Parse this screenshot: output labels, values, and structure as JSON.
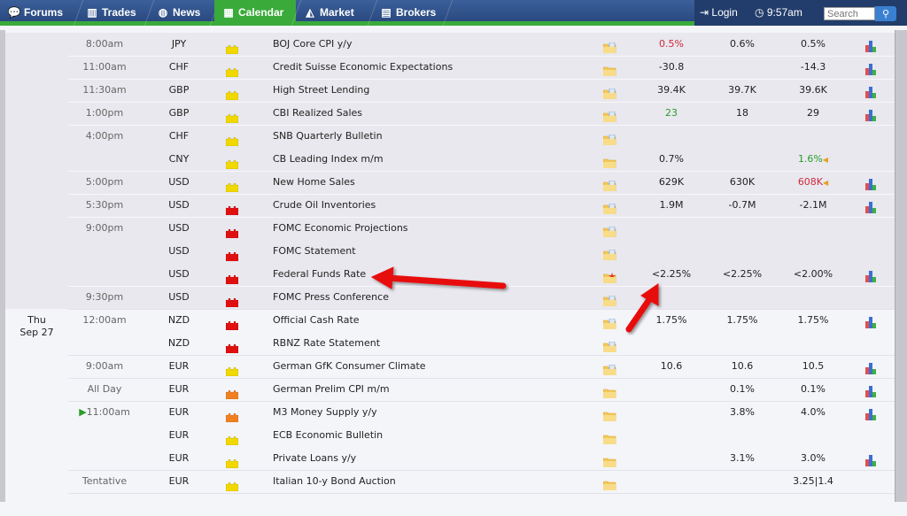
{
  "nav": {
    "tabs": [
      {
        "label": "Forums",
        "icon": "chat-bubbles-icon",
        "active": false
      },
      {
        "label": "Trades",
        "icon": "bar-chart-icon",
        "active": false
      },
      {
        "label": "News",
        "icon": "globe-icon",
        "active": false
      },
      {
        "label": "Calendar",
        "icon": "calendar-icon",
        "active": true
      },
      {
        "label": "Market",
        "icon": "line-chart-icon",
        "active": false
      },
      {
        "label": "Brokers",
        "icon": "brokers-icon",
        "active": false
      }
    ],
    "login": "Login",
    "time": "9:57am",
    "search_placeholder": "Search"
  },
  "colors": {
    "nav": "#2a4a80",
    "accent": "#3aab3a",
    "impact_high": "#e01010",
    "impact_medium": "#f08020",
    "impact_low": "#f0d800"
  },
  "days": [
    {
      "day": "",
      "date": ""
    },
    {
      "day": "Thu",
      "date": "Sep 27"
    }
  ],
  "rows": [
    {
      "day": 0,
      "time": "8:00am",
      "currency": "JPY",
      "impact": "low",
      "event": "BOJ Core CPI y/y",
      "detail": "doc",
      "actual": "0.5%",
      "actual_color": "red",
      "forecast": "0.6%",
      "previous": "0.5%",
      "chart": true
    },
    {
      "day": 0,
      "time": "11:00am",
      "currency": "CHF",
      "impact": "low",
      "event": "Credit Suisse Economic Expectations",
      "detail": "folder",
      "actual": "-30.8",
      "forecast": "",
      "previous": "-14.3",
      "chart": true
    },
    {
      "day": 0,
      "time": "11:30am",
      "currency": "GBP",
      "impact": "low",
      "event": "High Street Lending",
      "detail": "doc",
      "actual": "39.4K",
      "forecast": "39.7K",
      "previous": "39.6K",
      "chart": true
    },
    {
      "day": 0,
      "time": "1:00pm",
      "currency": "GBP",
      "impact": "low",
      "event": "CBI Realized Sales",
      "detail": "doc",
      "actual": "23",
      "actual_color": "green",
      "forecast": "18",
      "previous": "29",
      "chart": true
    },
    {
      "day": 0,
      "time": "4:00pm",
      "currency": "CHF",
      "impact": "low",
      "event": "SNB Quarterly Bulletin",
      "detail": "doc",
      "actual": "",
      "forecast": "",
      "previous": "",
      "chart": false
    },
    {
      "day": 0,
      "time": "",
      "currency": "CNY",
      "impact": "low",
      "event": "CB Leading Index m/m",
      "detail": "folder",
      "actual": "0.7%",
      "forecast": "",
      "previous": "1.6%",
      "previous_color": "green",
      "revised": true,
      "chart": false
    },
    {
      "day": 0,
      "time": "5:00pm",
      "currency": "USD",
      "impact": "low",
      "event": "New Home Sales",
      "detail": "doc",
      "actual": "629K",
      "forecast": "630K",
      "previous": "608K",
      "previous_color": "red",
      "revised": true,
      "chart": true
    },
    {
      "day": 0,
      "time": "5:30pm",
      "currency": "USD",
      "impact": "high",
      "event": "Crude Oil Inventories",
      "detail": "doc",
      "actual": "1.9M",
      "forecast": "-0.7M",
      "previous": "-2.1M",
      "chart": true
    },
    {
      "day": 0,
      "time": "9:00pm",
      "currency": "USD",
      "impact": "high",
      "event": "FOMC Economic Projections",
      "detail": "doc",
      "actual": "",
      "forecast": "",
      "previous": "",
      "chart": false
    },
    {
      "day": 0,
      "time": "",
      "currency": "USD",
      "impact": "high",
      "event": "FOMC Statement",
      "detail": "doc",
      "actual": "",
      "forecast": "",
      "previous": "",
      "chart": false
    },
    {
      "day": 0,
      "time": "",
      "currency": "USD",
      "impact": "high",
      "event": "Federal Funds Rate",
      "detail": "star",
      "actual": "<2.25%",
      "forecast": "<2.25%",
      "previous": "<2.00%",
      "chart": true
    },
    {
      "day": 0,
      "time": "9:30pm",
      "currency": "USD",
      "impact": "high",
      "event": "FOMC Press Conference",
      "detail": "doc",
      "actual": "",
      "forecast": "",
      "previous": "",
      "chart": false
    },
    {
      "day": 1,
      "time": "12:00am",
      "currency": "NZD",
      "impact": "high",
      "event": "Official Cash Rate",
      "detail": "doc",
      "actual": "1.75%",
      "forecast": "1.75%",
      "previous": "1.75%",
      "chart": true
    },
    {
      "day": 1,
      "time": "",
      "currency": "NZD",
      "impact": "high",
      "event": "RBNZ Rate Statement",
      "detail": "doc",
      "actual": "",
      "forecast": "",
      "previous": "",
      "chart": false
    },
    {
      "day": 1,
      "time": "9:00am",
      "currency": "EUR",
      "impact": "low",
      "event": "German GfK Consumer Climate",
      "detail": "doc",
      "actual": "10.6",
      "forecast": "10.6",
      "previous": "10.5",
      "chart": true
    },
    {
      "day": 1,
      "time": "All Day",
      "currency": "EUR",
      "impact": "medium",
      "event": "German Prelim CPI m/m",
      "detail": "folder",
      "actual": "",
      "forecast": "0.1%",
      "previous": "0.1%",
      "chart": true
    },
    {
      "day": 1,
      "time": "11:00am",
      "next": true,
      "currency": "EUR",
      "impact": "medium",
      "event": "M3 Money Supply y/y",
      "detail": "folder",
      "actual": "",
      "forecast": "3.8%",
      "previous": "4.0%",
      "chart": true
    },
    {
      "day": 1,
      "time": "",
      "currency": "EUR",
      "impact": "low",
      "event": "ECB Economic Bulletin",
      "detail": "folder",
      "actual": "",
      "forecast": "",
      "previous": "",
      "chart": false
    },
    {
      "day": 1,
      "time": "",
      "currency": "EUR",
      "impact": "low",
      "event": "Private Loans y/y",
      "detail": "folder",
      "actual": "",
      "forecast": "3.1%",
      "previous": "3.0%",
      "chart": true
    },
    {
      "day": 1,
      "time": "Tentative",
      "currency": "EUR",
      "impact": "low",
      "event": "Italian 10-y Bond Auction",
      "detail": "folder",
      "actual": "",
      "forecast": "",
      "previous": "3.25|1.4",
      "chart": false
    }
  ]
}
